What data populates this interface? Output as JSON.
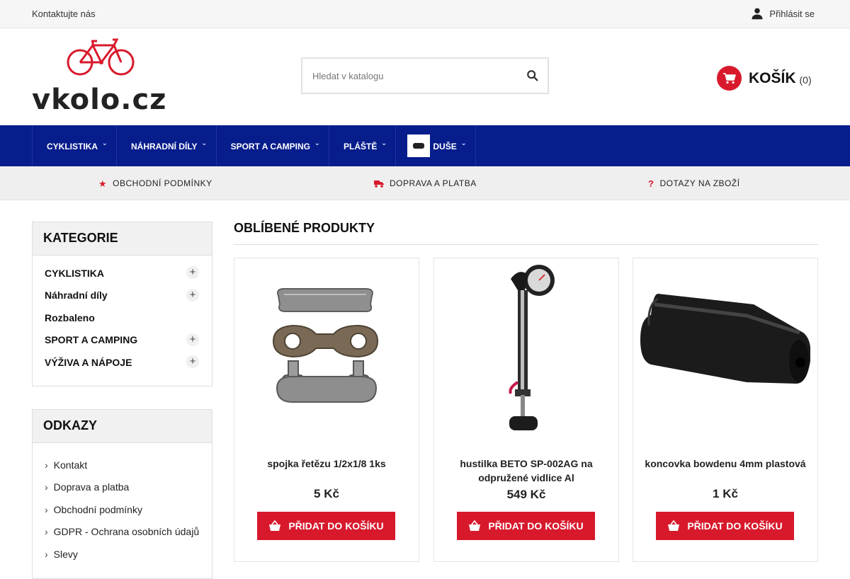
{
  "topbar": {
    "contact_label": "Kontaktujte nás",
    "login_label": "Přihlásit se",
    "login_icon": "user-icon"
  },
  "header": {
    "logo_text": "vkolo.cz",
    "logo_icon": "bicycle-logo",
    "search_placeholder": "Hledat v katalogu",
    "search_icon": "search-icon",
    "cart_label": "KOŠÍK",
    "cart_count": "(0)",
    "cart_icon": "shopping-cart-icon"
  },
  "colors": {
    "accent": "#d8192c",
    "nav_bg": "#071d8c"
  },
  "nav": {
    "items": [
      {
        "label": "CYKLISTIKA"
      },
      {
        "label": "NÁHRADNÍ DÍLY"
      },
      {
        "label": "SPORT A CAMPING"
      },
      {
        "label": "PLÁŠTĚ"
      },
      {
        "label": "DUŠE"
      }
    ]
  },
  "infobar": {
    "items": [
      {
        "label": "OBCHODNÍ PODMÍNKY",
        "icon": "star-icon"
      },
      {
        "label": "DOPRAVA A PLATBA",
        "icon": "truck-icon"
      },
      {
        "label": "DOTAZY NA ZBOŽÍ",
        "icon": "question-icon"
      }
    ]
  },
  "sidebar": {
    "categories_title": "KATEGORIE",
    "categories": [
      {
        "label": "CYKLISTIKA",
        "expandable": true
      },
      {
        "label": "Náhradní díly",
        "expandable": true
      },
      {
        "label": "Rozbaleno",
        "expandable": false
      },
      {
        "label": "SPORT A CAMPING",
        "expandable": true
      },
      {
        "label": "VÝŽIVA A NÁPOJE",
        "expandable": true
      }
    ],
    "links_title": "ODKAZY",
    "links": [
      {
        "label": "Kontakt"
      },
      {
        "label": "Doprava a platba"
      },
      {
        "label": "Obchodní podmínky"
      },
      {
        "label": "GDPR - Ochrana osobních údajů"
      },
      {
        "label": "Slevy"
      }
    ]
  },
  "products": {
    "title": "OBLÍBENÉ PRODUKTY",
    "add_to_cart_label": "PŘIDAT DO KOŠÍKU",
    "items": [
      {
        "name": "spojka řetězu 1/2x1/8 1ks",
        "price": "5 Kč",
        "image": "chain-link-image"
      },
      {
        "name": "hustilka BETO SP-002AG na odpružené vidlice Al",
        "price": "549 Kč",
        "image": "shock-pump-image"
      },
      {
        "name": "koncovka bowdenu 4mm plastová",
        "price": "1 Kč",
        "image": "cable-end-cap-image"
      }
    ]
  }
}
